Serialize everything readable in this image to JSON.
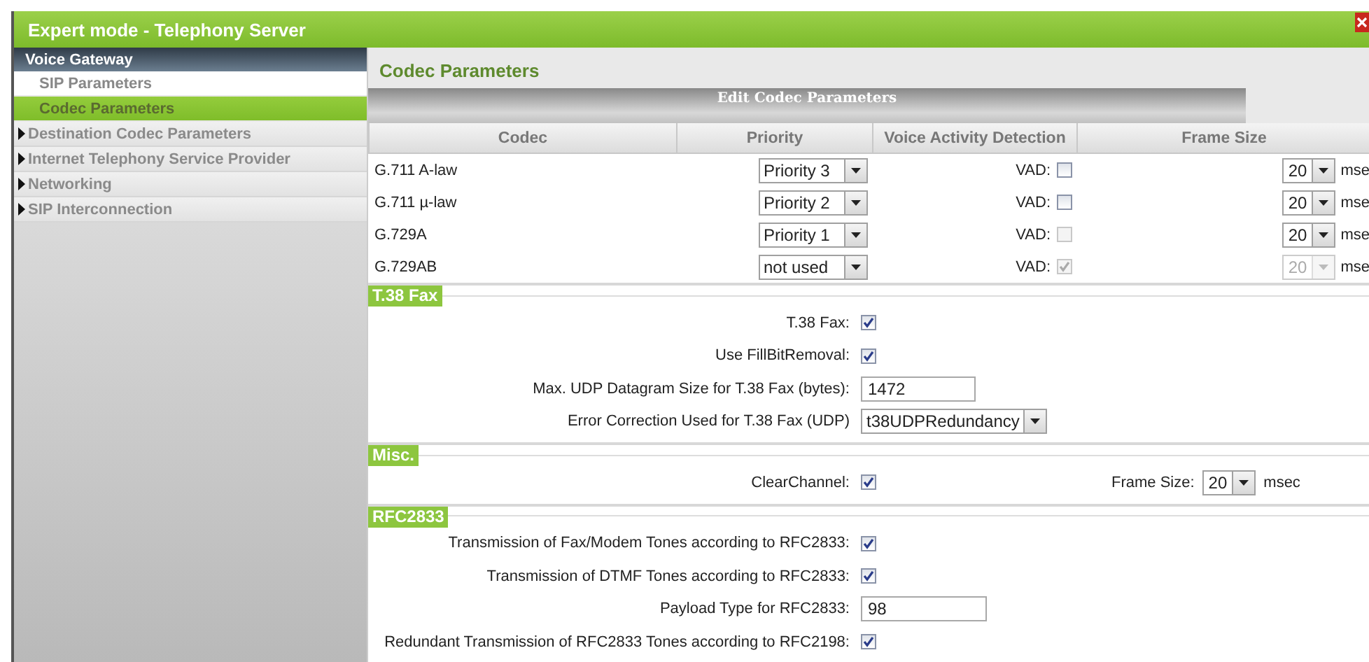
{
  "window": {
    "title": "Expert mode - Telephony Server"
  },
  "sidebar": {
    "header": "Voice Gateway",
    "items": [
      {
        "kind": "sub",
        "label": "SIP Parameters",
        "selected": false
      },
      {
        "kind": "sub",
        "label": "Codec Parameters",
        "selected": true
      },
      {
        "kind": "folder",
        "label": "Destination Codec Parameters",
        "selected": false,
        "expanded": false
      },
      {
        "kind": "folder",
        "label": "Internet Telephony Service Provider",
        "selected": false,
        "expanded": false
      },
      {
        "kind": "folder",
        "label": "Networking",
        "selected": false,
        "expanded": false
      },
      {
        "kind": "folder",
        "label": "SIP Interconnection",
        "selected": false,
        "expanded": false
      }
    ]
  },
  "content": {
    "title": "Codec Parameters",
    "panel_title": "Edit Codec Parameters",
    "codec_table": {
      "columns": [
        "Codec",
        "Priority",
        "Voice Activity Detection",
        "Frame Size"
      ],
      "rows": [
        {
          "codec": "G.711 A-law",
          "priority": "Priority 3",
          "vad_label": "VAD:",
          "vad_checked": false,
          "vad_disabled": false,
          "frame_size": "20",
          "frame_disabled": false,
          "unit": "mse"
        },
        {
          "codec": "G.711 µ-law",
          "priority": "Priority 2",
          "vad_label": "VAD:",
          "vad_checked": false,
          "vad_disabled": false,
          "frame_size": "20",
          "frame_disabled": false,
          "unit": "mse"
        },
        {
          "codec": "G.729A",
          "priority": "Priority 1",
          "vad_label": "VAD:",
          "vad_checked": false,
          "vad_disabled": true,
          "frame_size": "20",
          "frame_disabled": false,
          "unit": "mse"
        },
        {
          "codec": "G.729AB",
          "priority": "not used",
          "vad_label": "VAD:",
          "vad_checked": true,
          "vad_disabled": true,
          "frame_size": "20",
          "frame_disabled": true,
          "unit": "mse"
        }
      ]
    },
    "sections": [
      {
        "title": "T.38 Fax",
        "fields": [
          {
            "kind": "checkbox",
            "label": "T.38 Fax:",
            "checked": true
          },
          {
            "kind": "checkbox",
            "label": "Use FillBitRemoval:",
            "checked": true
          },
          {
            "kind": "text",
            "label": "Max. UDP Datagram Size for T.38 Fax (bytes):",
            "value": "1472"
          },
          {
            "kind": "select",
            "label": "Error Correction Used for T.38 Fax (UDP)",
            "value": "t38UDPRedundancy"
          }
        ]
      },
      {
        "title": "Misc.",
        "fields": [
          {
            "kind": "checkbox",
            "label": "ClearChannel:",
            "checked": true
          },
          {
            "kind": "unit_select",
            "label": "Frame Size:",
            "value": "20",
            "unit": "msec"
          }
        ]
      },
      {
        "title": "RFC2833",
        "fields": [
          {
            "kind": "checkbox",
            "label": "Transmission of Fax/Modem Tones according to RFC2833:",
            "checked": true
          },
          {
            "kind": "checkbox",
            "label": "Transmission of DTMF Tones according to RFC2833:",
            "checked": true
          },
          {
            "kind": "text",
            "label": "Payload Type for RFC2833:",
            "value": "98"
          },
          {
            "kind": "checkbox",
            "label": "Redundant Transmission of RFC2833 Tones according to RFC2198:",
            "checked": true
          }
        ]
      }
    ]
  }
}
